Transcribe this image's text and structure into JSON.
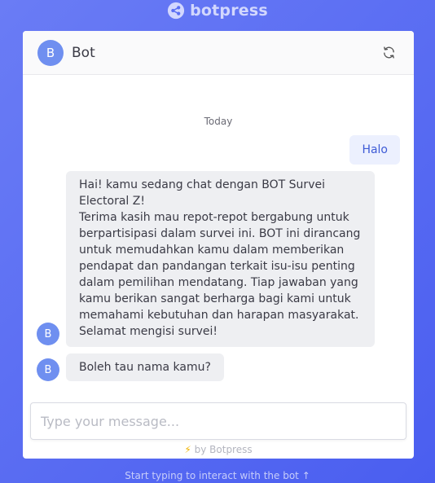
{
  "brand": {
    "name": "botpress",
    "icon": "botpress-logo-icon"
  },
  "header": {
    "avatar_letter": "B",
    "bot_name": "Bot",
    "refresh_icon": "refresh-icon"
  },
  "conversation": {
    "date_label": "Today",
    "user_message": "Halo",
    "bot_avatar_letter": "B",
    "bot_messages": [
      "Hai! kamu sedang chat dengan BOT Survei\nElectoral Z!\nTerima kasih mau repot-repot bergabung untuk\nberpartisipasi dalam survei ini. BOT ini dirancang\nuntuk memudahkan kamu dalam memberikan\npendapat dan pandangan terkait isu-isu penting\ndalam pemilihan mendatang. Tiap jawaban yang\nkamu berikan sangat berharga bagi kami untuk\nmemahami kebutuhan dan harapan masyarakat.\nSelamat mengisi survei!",
      "Boleh tau nama kamu?"
    ]
  },
  "composer": {
    "placeholder": "Type your message...",
    "powered_by": "by Botpress",
    "bolt_icon": "⚡"
  },
  "footer": {
    "hint": "Start typing to interact with the bot",
    "arrow": "↑"
  },
  "colors": {
    "background": "#5468f2",
    "avatar": "#6f8ff0",
    "user_bubble": "#ecf0fe",
    "user_text": "#3e5bd6"
  }
}
